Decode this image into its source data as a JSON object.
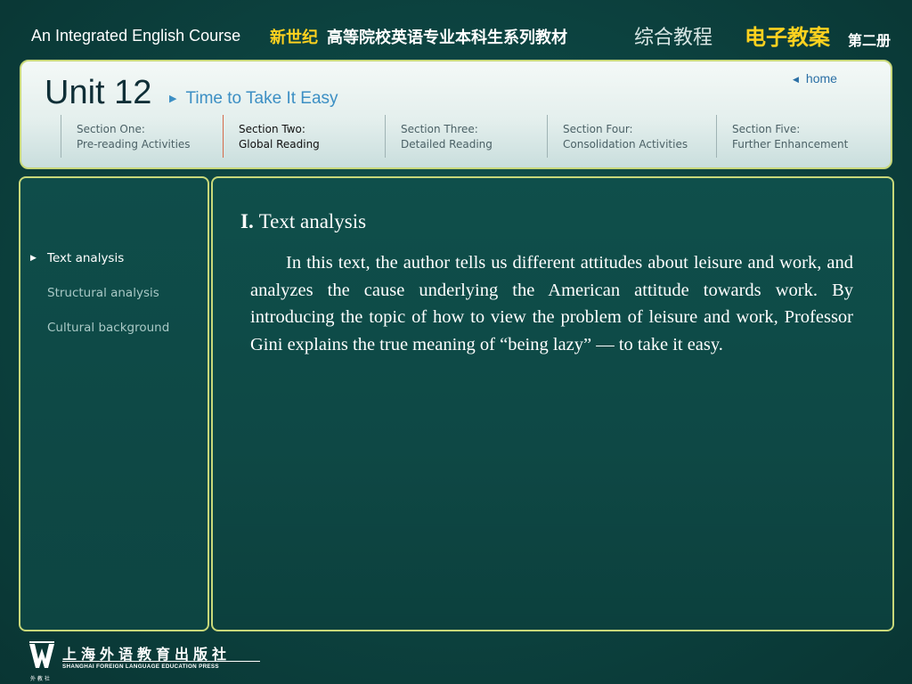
{
  "banner": {
    "course_en": "An Integrated English Course",
    "xinshiji": "新世纪",
    "series": "高等院校英语专业本科生系列教材",
    "zonghe": "综合教程",
    "dianzi": "电子教案",
    "volume": "第二册"
  },
  "header": {
    "unit": "Unit 12",
    "unit_subtitle": "Time to Take It Easy",
    "home_label": "home",
    "sections": [
      {
        "line1": "Section One:",
        "line2": "Pre-reading Activities"
      },
      {
        "line1": "Section Two:",
        "line2": "Global Reading"
      },
      {
        "line1": "Section Three:",
        "line2": "Detailed Reading"
      },
      {
        "line1": "Section Four:",
        "line2": "Consolidation Activities"
      },
      {
        "line1": "Section Five:",
        "line2": "Further Enhancement"
      }
    ],
    "active_section_index": 1
  },
  "nav": {
    "items": [
      {
        "label": "Text analysis"
      },
      {
        "label": "Structural analysis"
      },
      {
        "label": "Cultural background"
      }
    ],
    "active_index": 0
  },
  "content": {
    "number": "I.",
    "heading": "Text analysis",
    "body": "In this text, the author tells us different attitudes about leisure and work, and analyzes the cause underlying the American attitude towards work. By introducing the topic of how to view the problem of leisure and work, Professor Gini explains the true meaning of “being lazy” — to take it easy."
  },
  "footer": {
    "publisher_cn": "上海外语教育出版社",
    "publisher_en": "SHANGHAI FOREIGN LANGUAGE EDUCATION PRESS",
    "logo_small": "外 教 社"
  },
  "colors": {
    "accent_yellow": "#ffd21f",
    "panel_border": "#c8d87a",
    "link_blue": "#3c8fc4",
    "active_divider": "#d46a4a"
  }
}
